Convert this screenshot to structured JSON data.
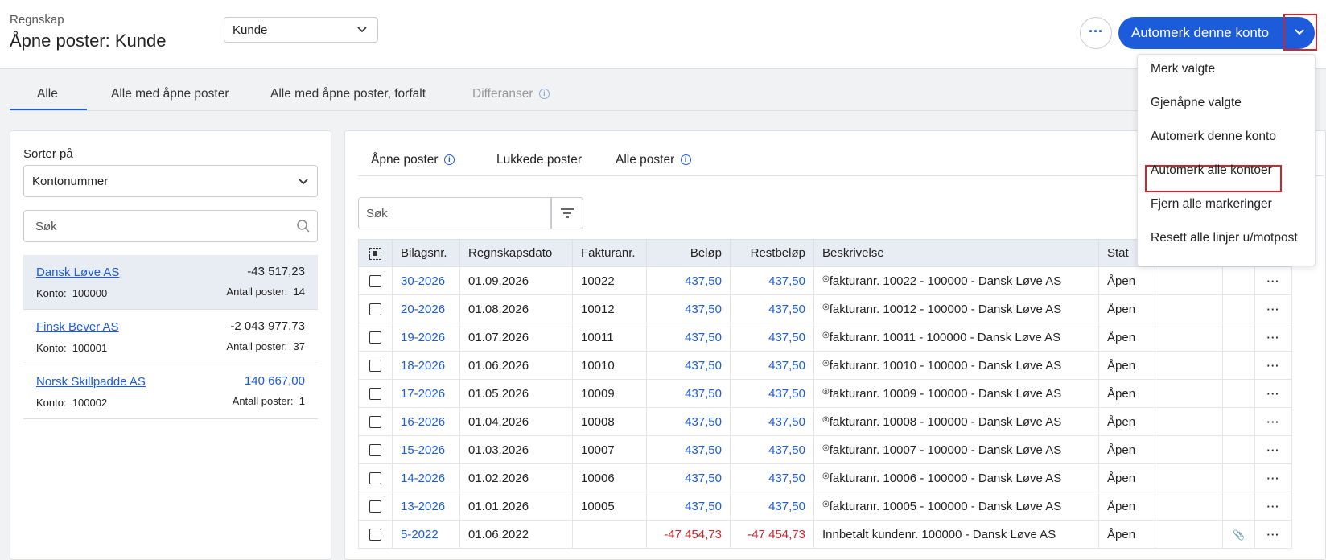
{
  "header": {
    "breadcrumb": "Regnskap",
    "title": "Åpne poster: Kunde",
    "type_select": "Kunde",
    "more_label": "···",
    "primary_button": "Automerk denne konto"
  },
  "tabs": [
    "Alle",
    "Alle med åpne poster",
    "Alle med åpne poster, forfalt",
    "Differanser"
  ],
  "info_glyph": "i",
  "left": {
    "sort_label": "Sorter på",
    "sort_value": "Kontonummer",
    "search_placeholder": "Søk",
    "konto_label": "Konto:",
    "count_label": "Antall poster:",
    "accounts": [
      {
        "name": "Dansk Løve AS",
        "balance": "-43 517,23",
        "konto": "100000",
        "count": "14"
      },
      {
        "name": "Finsk Bever AS",
        "balance": "-2 043 977,73",
        "konto": "100001",
        "count": "37"
      },
      {
        "name": "Norsk Skillpadde AS",
        "balance": "140 667,00",
        "konto": "100002",
        "count": "1"
      }
    ]
  },
  "right": {
    "subtabs": [
      "Åpne poster",
      "Lukkede poster",
      "Alle poster"
    ],
    "search_placeholder": "Søk",
    "columns": [
      "Bilagsnr.",
      "Regnskapsdato",
      "Fakturanr.",
      "Beløp",
      "Restbeløp",
      "Beskrivelse",
      "Stat"
    ],
    "rows": [
      {
        "bilag": "30-2026",
        "dato": "01.09.2026",
        "faktura": "10022",
        "belop": "437,50",
        "rest": "437,50",
        "beskr": "fakturanr. 10022 - 100000 - Dansk Løve AS",
        "status": "Åpen"
      },
      {
        "bilag": "20-2026",
        "dato": "01.08.2026",
        "faktura": "10012",
        "belop": "437,50",
        "rest": "437,50",
        "beskr": "fakturanr. 10012 - 100000 - Dansk Løve AS",
        "status": "Åpen"
      },
      {
        "bilag": "19-2026",
        "dato": "01.07.2026",
        "faktura": "10011",
        "belop": "437,50",
        "rest": "437,50",
        "beskr": "fakturanr. 10011 - 100000 - Dansk Løve AS",
        "status": "Åpen"
      },
      {
        "bilag": "18-2026",
        "dato": "01.06.2026",
        "faktura": "10010",
        "belop": "437,50",
        "rest": "437,50",
        "beskr": "fakturanr. 10010 - 100000 - Dansk Løve AS",
        "status": "Åpen"
      },
      {
        "bilag": "17-2026",
        "dato": "01.05.2026",
        "faktura": "10009",
        "belop": "437,50",
        "rest": "437,50",
        "beskr": "fakturanr. 10009 - 100000 - Dansk Løve AS",
        "status": "Åpen"
      },
      {
        "bilag": "16-2026",
        "dato": "01.04.2026",
        "faktura": "10008",
        "belop": "437,50",
        "rest": "437,50",
        "beskr": "fakturanr. 10008 - 100000 - Dansk Løve AS",
        "status": "Åpen"
      },
      {
        "bilag": "15-2026",
        "dato": "01.03.2026",
        "faktura": "10007",
        "belop": "437,50",
        "rest": "437,50",
        "beskr": "fakturanr. 10007 - 100000 - Dansk Løve AS",
        "status": "Åpen"
      },
      {
        "bilag": "14-2026",
        "dato": "01.02.2026",
        "faktura": "10006",
        "belop": "437,50",
        "rest": "437,50",
        "beskr": "fakturanr. 10006 - 100000 - Dansk Løve AS",
        "status": "Åpen"
      },
      {
        "bilag": "13-2026",
        "dato": "01.01.2026",
        "faktura": "10005",
        "belop": "437,50",
        "rest": "437,50",
        "beskr": "fakturanr. 10005 - 100000 - Dansk Løve AS",
        "status": "Åpen"
      },
      {
        "bilag": "5-2022",
        "dato": "01.06.2022",
        "faktura": "",
        "belop": "-47 454,73",
        "rest": "-47 454,73",
        "beskr": "Innbetalt kundenr. 100000 - Dansk Løve AS",
        "status": "Åpen"
      }
    ]
  },
  "dropdown": [
    "Merk valgte",
    "Gjenåpne valgte",
    "Automerk denne konto",
    "Automerk alle kontoer",
    "Fjern alle markeringer",
    "Resett alle linjer u/motpost"
  ],
  "colors": {
    "accent": "#1c5bd9",
    "negative": "#d3232b",
    "highlight": "#d3232b"
  }
}
